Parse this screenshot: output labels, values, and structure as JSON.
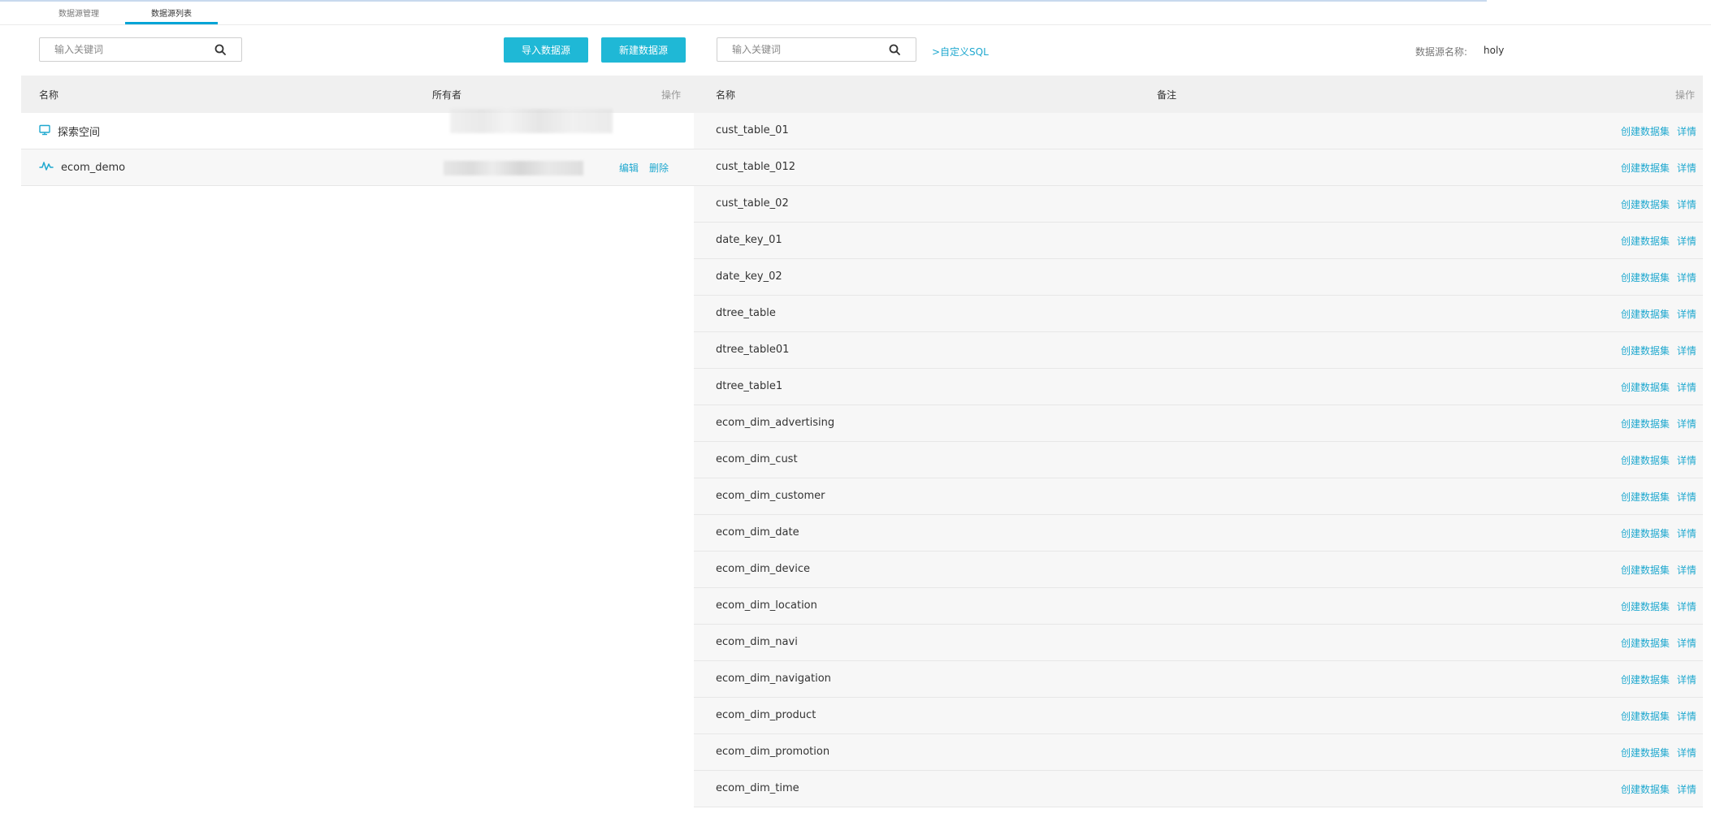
{
  "tabs": [
    "数据源管理",
    "数据源列表"
  ],
  "left": {
    "search_placeholder": "输入关键词",
    "import_button": "导入数据源",
    "new_button": "新建数据源",
    "columns": {
      "name": "名称",
      "owner": "所有者",
      "action": "操作"
    },
    "rows": [
      {
        "name": "探索空间",
        "icon": "monitor-icon"
      },
      {
        "name": "ecom_demo",
        "icon": "waveform-icon",
        "edit": "编辑",
        "delete": "删除"
      }
    ]
  },
  "right": {
    "search_placeholder": "输入关键词",
    "custom_sql": ">自定义SQL",
    "datasource_label": "数据源名称:",
    "datasource_value": "holy",
    "columns": {
      "name": "名称",
      "remark": "备注",
      "action": "操作"
    },
    "action_create": "创建数据集",
    "action_detail": "详情",
    "tables": [
      "cust_table_01",
      "cust_table_012",
      "cust_table_02",
      "date_key_01",
      "date_key_02",
      "dtree_table",
      "dtree_table01",
      "dtree_table1",
      "ecom_dim_advertising",
      "ecom_dim_cust",
      "ecom_dim_customer",
      "ecom_dim_date",
      "ecom_dim_device",
      "ecom_dim_location",
      "ecom_dim_navi",
      "ecom_dim_navigation",
      "ecom_dim_product",
      "ecom_dim_promotion",
      "ecom_dim_time"
    ]
  },
  "colors": {
    "accent": "#1fb8d6",
    "link": "#1fa8cf",
    "header_bg": "#f0f0f0",
    "row_bg": "#f7f7f7"
  }
}
